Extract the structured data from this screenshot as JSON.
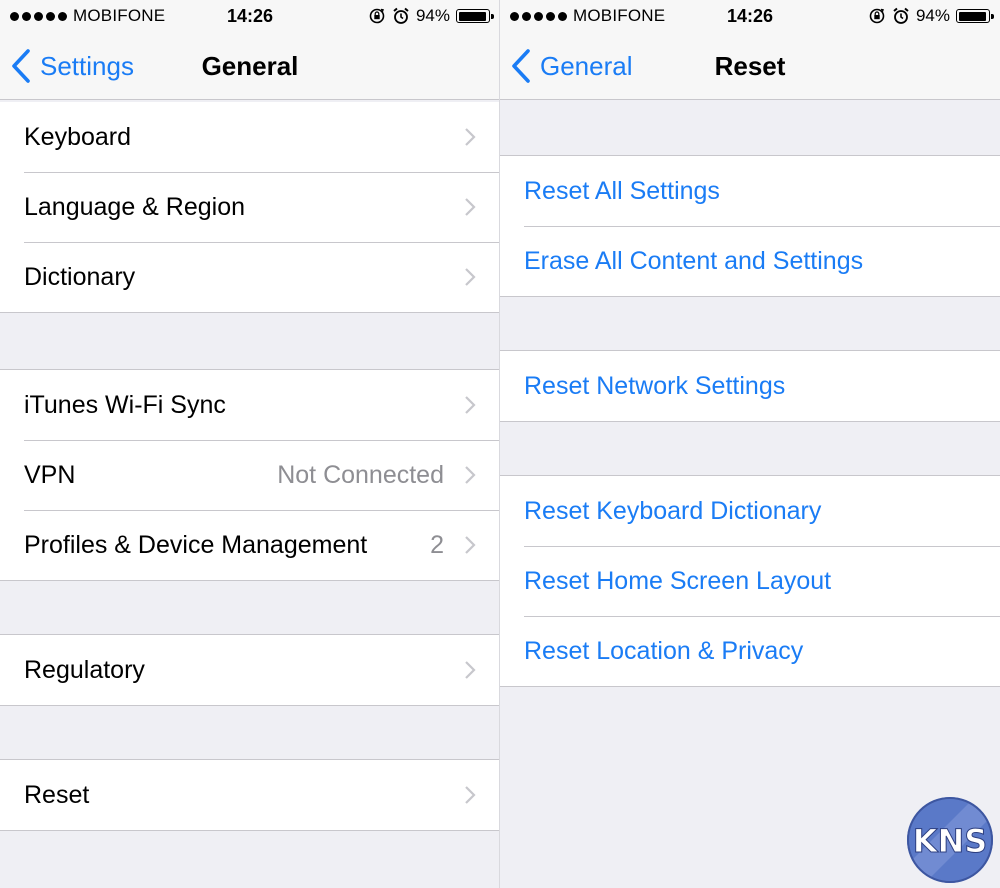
{
  "status_bar": {
    "carrier": "MOBIFONE",
    "time": "14:26",
    "battery_percent": "94%",
    "battery_level": 0.94,
    "icons": [
      "signal-dots",
      "rotation-lock-icon",
      "alarm-icon",
      "battery-icon"
    ]
  },
  "left": {
    "nav": {
      "back_label": "Settings",
      "title": "General"
    },
    "groups": [
      {
        "rows": [
          {
            "label": "Keyboard",
            "value": ""
          },
          {
            "label": "Language & Region",
            "value": ""
          },
          {
            "label": "Dictionary",
            "value": ""
          }
        ]
      },
      {
        "rows": [
          {
            "label": "iTunes Wi-Fi Sync",
            "value": ""
          },
          {
            "label": "VPN",
            "value": "Not Connected"
          },
          {
            "label": "Profiles & Device Management",
            "value": "2"
          }
        ]
      },
      {
        "rows": [
          {
            "label": "Regulatory",
            "value": ""
          }
        ]
      },
      {
        "rows": [
          {
            "label": "Reset",
            "value": ""
          }
        ]
      }
    ]
  },
  "right": {
    "nav": {
      "back_label": "General",
      "title": "Reset"
    },
    "groups": [
      {
        "rows": [
          {
            "label": "Reset All Settings"
          },
          {
            "label": "Erase All Content and Settings"
          }
        ]
      },
      {
        "rows": [
          {
            "label": "Reset Network Settings"
          }
        ]
      },
      {
        "rows": [
          {
            "label": "Reset Keyboard Dictionary"
          },
          {
            "label": "Reset Home Screen Layout"
          },
          {
            "label": "Reset Location & Privacy"
          }
        ]
      }
    ]
  },
  "watermark": {
    "text": "KNS"
  },
  "colors": {
    "accent": "#1a7cf5",
    "background": "#efeff4",
    "separator": "#c8c7cc",
    "secondary_text": "#8e8e93"
  }
}
